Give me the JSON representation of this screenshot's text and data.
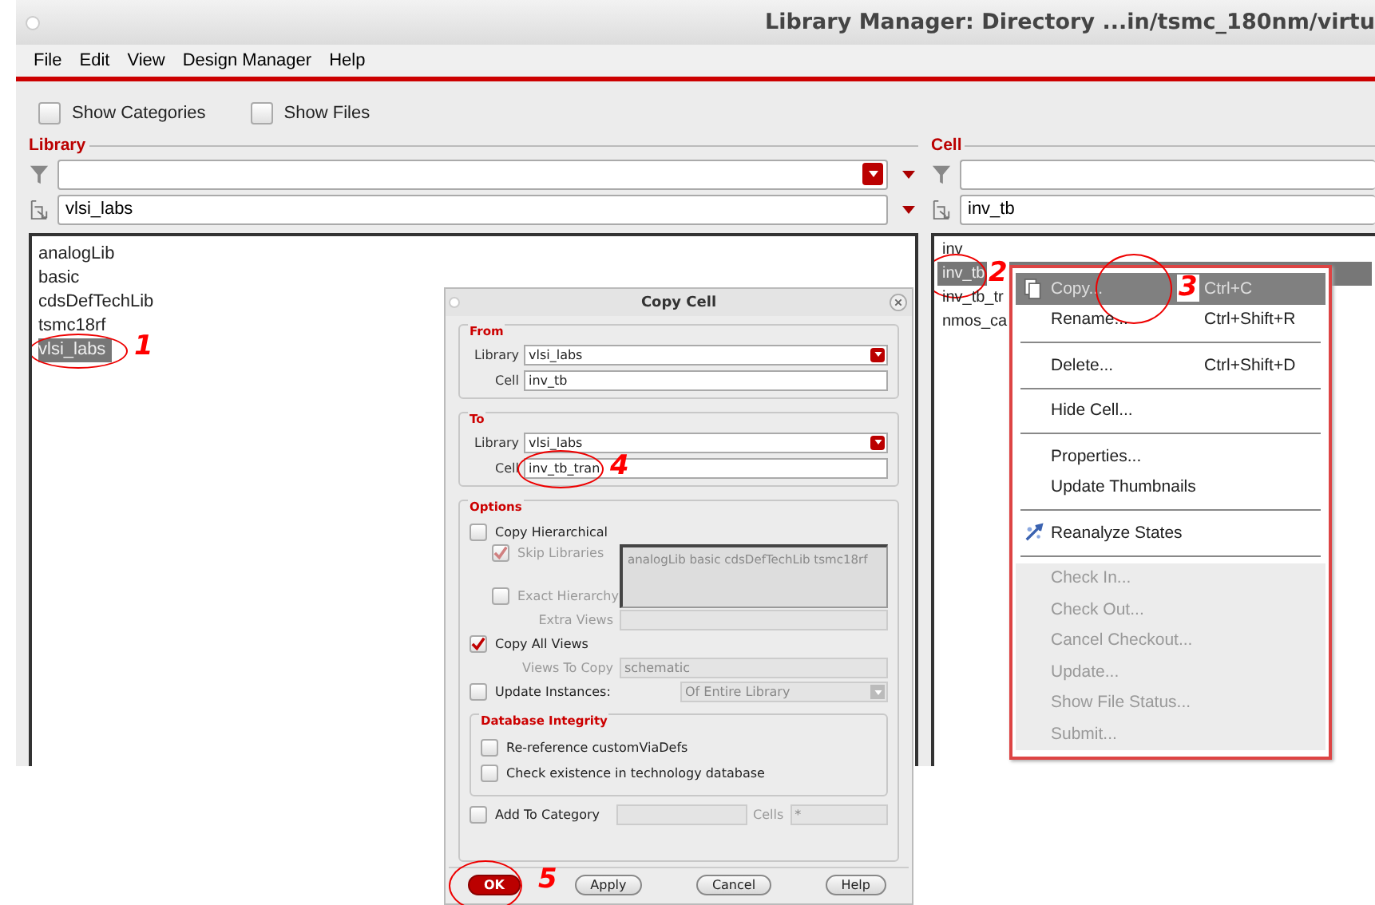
{
  "window": {
    "title": "Library Manager: Directory ...in/tsmc_180nm/virtu"
  },
  "menu_bar": [
    "File",
    "Edit",
    "View",
    "Design Manager",
    "Help"
  ],
  "view_options": [
    {
      "label": "Show Categories",
      "checked": false
    },
    {
      "label": "Show Files",
      "checked": false
    }
  ],
  "library_panel": {
    "heading": "Library",
    "library": "vlsi_labs",
    "items": [
      {
        "label": "analogLib",
        "selected": false
      },
      {
        "label": "basic",
        "selected": false
      },
      {
        "label": "cdsDefTechLib",
        "selected": false
      },
      {
        "label": "tsmc18rf",
        "selected": false
      },
      {
        "label": "vlsi_labs",
        "selected": true,
        "step": "1"
      }
    ]
  },
  "cell_panel": {
    "heading": "Cell",
    "cell": "inv_tb",
    "items": [
      {
        "label": "inv",
        "selected": false
      },
      {
        "label": "inv_tb",
        "selected": true,
        "step": "2"
      },
      {
        "label": "inv_tb_tr",
        "selected": false
      },
      {
        "label": "nmos_ca",
        "selected": false
      }
    ]
  },
  "context_menu": {
    "items": [
      {
        "kind": "item",
        "label": "Copy...",
        "shortcut": "Ctrl+C",
        "selected": true,
        "disabled": false,
        "step": "3"
      },
      {
        "kind": "item",
        "label": "Rename...",
        "shortcut": "Ctrl+Shift+R",
        "selected": false,
        "disabled": false
      },
      {
        "kind": "separator"
      },
      {
        "kind": "item",
        "label": "Delete...",
        "shortcut": "Ctrl+Shift+D",
        "selected": false,
        "disabled": false
      },
      {
        "kind": "separator"
      },
      {
        "kind": "item",
        "label": "Hide Cell...",
        "selected": false,
        "disabled": false
      },
      {
        "kind": "separator"
      },
      {
        "kind": "item",
        "label": "Properties...",
        "selected": false,
        "disabled": false
      },
      {
        "kind": "item",
        "label": "Update Thumbnails",
        "selected": false,
        "disabled": false
      },
      {
        "kind": "separator"
      },
      {
        "kind": "item",
        "label": "Reanalyze States",
        "selected": false,
        "disabled": false
      },
      {
        "kind": "separator"
      },
      {
        "kind": "item",
        "label": "Check In...",
        "selected": false,
        "disabled": true
      },
      {
        "kind": "item",
        "label": "Check Out...",
        "selected": false,
        "disabled": true
      },
      {
        "kind": "item",
        "label": "Cancel Checkout...",
        "selected": false,
        "disabled": true
      },
      {
        "kind": "item",
        "label": "Update...",
        "selected": false,
        "disabled": true
      },
      {
        "kind": "item",
        "label": "Show File Status...",
        "selected": false,
        "disabled": true
      },
      {
        "kind": "item",
        "label": "Submit...",
        "selected": false,
        "disabled": true
      }
    ]
  },
  "copy_cell_dialog": {
    "title": "Copy Cell",
    "from": {
      "heading": "From",
      "library_label": "Library",
      "library": "vlsi_labs",
      "cell_label": "Cell",
      "cell": "inv_tb"
    },
    "to": {
      "heading": "To",
      "library_label": "Library",
      "library": "vlsi_labs",
      "cell_label": "Cell",
      "cell": "inv_tb_tran",
      "step": "4"
    },
    "options": {
      "heading": "Options",
      "copy_hierarchical": {
        "label": "Copy Hierarchical",
        "checked": false,
        "disabled": false
      },
      "skip_libraries": {
        "label": "Skip Libraries",
        "checked": true,
        "disabled": true
      },
      "skip_list": "analogLib basic cdsDefTechLib tsmc18rf",
      "exact_hierarchy": {
        "label": "Exact Hierarchy",
        "checked": false,
        "disabled": true
      },
      "extra_views_label": "Extra Views",
      "copy_all_views": {
        "label": "Copy All Views",
        "checked": true,
        "disabled": false
      },
      "views_to_copy_label": "Views To Copy",
      "views_to_copy": "schematic",
      "update_instances": {
        "label": "Update Instances:",
        "checked": false,
        "disabled": false
      },
      "update_scope": "Of Entire Library",
      "database_integrity": {
        "heading": "Database Integrity",
        "options": [
          {
            "label": "Re-reference customViaDefs",
            "checked": false,
            "disabled": false
          },
          {
            "label": "Check existence in technology database",
            "checked": false,
            "disabled": false
          }
        ]
      },
      "add_to_category": {
        "label": "Add To Category",
        "checked": false,
        "disabled": false
      },
      "cells_label": "Cells",
      "cells": "*"
    },
    "buttons": [
      {
        "label": "OK",
        "kind": "primary",
        "step": "5"
      },
      {
        "label": "Apply",
        "kind": "normal"
      },
      {
        "label": "Cancel",
        "kind": "normal"
      },
      {
        "label": "Help",
        "kind": "normal"
      }
    ]
  }
}
